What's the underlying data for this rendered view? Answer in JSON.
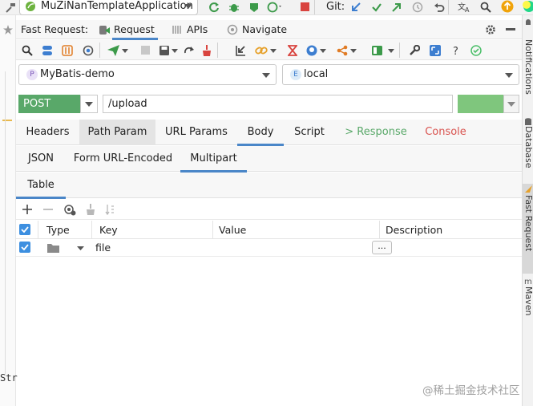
{
  "topbar": {
    "run_config": "MuZiNanTemplateApplication",
    "git_label": "Git:"
  },
  "plugin": {
    "title": "Fast Request:",
    "tabs": [
      "Request",
      "APIs",
      "Navigate"
    ]
  },
  "project_select": {
    "badge": "P",
    "value": "MyBatis-demo"
  },
  "env_select": {
    "badge": "E",
    "value": "local"
  },
  "request": {
    "method": "POST",
    "url": "/upload"
  },
  "tabs_main": [
    "Headers",
    "Path Param",
    "URL Params",
    "Body",
    "Script",
    "> Response",
    "Console"
  ],
  "tabs_body": [
    "JSON",
    "Form URL-Encoded",
    "Multipart"
  ],
  "tabs_view": [
    "Table"
  ],
  "table": {
    "columns": [
      "Type",
      "Key",
      "Value",
      "Description"
    ],
    "rows": [
      {
        "key": "file",
        "value": "",
        "description": "",
        "button": "..."
      }
    ]
  },
  "right_stripe": [
    "Notifications",
    "Database",
    "Fast Request",
    "Maven"
  ],
  "left_fragment": "Str",
  "watermark": "@稀土掘金技术社区",
  "colors": {
    "accent": "#4a86c8",
    "post": "#59a869",
    "response": "#59a869",
    "console": "#d9534f"
  }
}
